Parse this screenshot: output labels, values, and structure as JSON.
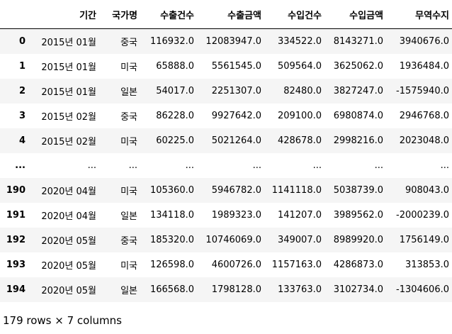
{
  "table": {
    "columns": [
      "",
      "기간",
      "국가명",
      "수출건수",
      "수출금액",
      "수입건수",
      "수입금액",
      "무역수지"
    ],
    "rows": [
      [
        "0",
        "2015년 01월",
        "중국",
        "116932.0",
        "12083947.0",
        "334522.0",
        "8143271.0",
        "3940676.0"
      ],
      [
        "1",
        "2015년 01월",
        "미국",
        "65888.0",
        "5561545.0",
        "509564.0",
        "3625062.0",
        "1936484.0"
      ],
      [
        "2",
        "2015년 01월",
        "일본",
        "54017.0",
        "2251307.0",
        "82480.0",
        "3827247.0",
        "-1575940.0"
      ],
      [
        "3",
        "2015년 02월",
        "중국",
        "86228.0",
        "9927642.0",
        "209100.0",
        "6980874.0",
        "2946768.0"
      ],
      [
        "4",
        "2015년 02월",
        "미국",
        "60225.0",
        "5021264.0",
        "428678.0",
        "2998216.0",
        "2023048.0"
      ],
      [
        "...",
        "...",
        "...",
        "...",
        "...",
        "...",
        "...",
        "..."
      ],
      [
        "190",
        "2020년 04월",
        "미국",
        "105360.0",
        "5946782.0",
        "1141118.0",
        "5038739.0",
        "908043.0"
      ],
      [
        "191",
        "2020년 04월",
        "일본",
        "134118.0",
        "1989323.0",
        "141207.0",
        "3989562.0",
        "-2000239.0"
      ],
      [
        "192",
        "2020년 05월",
        "중국",
        "185320.0",
        "10746069.0",
        "349007.0",
        "8989920.0",
        "1756149.0"
      ],
      [
        "193",
        "2020년 05월",
        "미국",
        "126598.0",
        "4600726.0",
        "1157163.0",
        "4286873.0",
        "313853.0"
      ],
      [
        "194",
        "2020년 05월",
        "일본",
        "166568.0",
        "1798128.0",
        "133763.0",
        "3102734.0",
        "-1304606.0"
      ]
    ]
  },
  "footer": {
    "shape_text": "179 rows × 7 columns"
  }
}
